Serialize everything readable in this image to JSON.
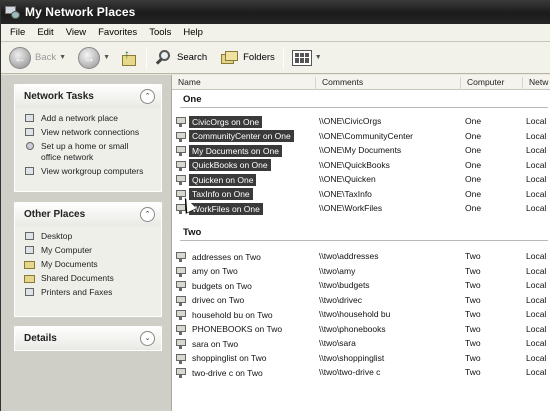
{
  "window": {
    "title": "My Network Places"
  },
  "menu": [
    "File",
    "Edit",
    "View",
    "Favorites",
    "Tools",
    "Help"
  ],
  "toolbar": {
    "back_label": "Back",
    "search_label": "Search",
    "folders_label": "Folders"
  },
  "left": {
    "network_tasks": {
      "title": "Network Tasks",
      "items": [
        "Add a network place",
        "View network connections",
        "Set up a home or small office network",
        "View workgroup computers"
      ]
    },
    "other_places": {
      "title": "Other Places",
      "items": [
        "Desktop",
        "My Computer",
        "My Documents",
        "Shared Documents",
        "Printers and Faxes"
      ]
    },
    "details": {
      "title": "Details"
    }
  },
  "columns": {
    "name": "Name",
    "comments": "Comments",
    "computer": "Computer",
    "network": "Netw"
  },
  "groups": [
    {
      "title": "One",
      "rows": [
        {
          "name": "CivicOrgs on One",
          "comment": "\\\\ONE\\CivicOrgs",
          "computer": "One",
          "network": "Local"
        },
        {
          "name": "CommunityCenter on One",
          "comment": "\\\\ONE\\CommunityCenter",
          "computer": "One",
          "network": "Local"
        },
        {
          "name": "My Documents on One",
          "comment": "\\\\ONE\\My Documents",
          "computer": "One",
          "network": "Local"
        },
        {
          "name": "QuickBooks on One",
          "comment": "\\\\ONE\\QuickBooks",
          "computer": "One",
          "network": "Local"
        },
        {
          "name": "Quicken on One",
          "comment": "\\\\ONE\\Quicken",
          "computer": "One",
          "network": "Local"
        },
        {
          "name": "TaxInfo on One",
          "comment": "\\\\ONE\\TaxInfo",
          "computer": "One",
          "network": "Local"
        },
        {
          "name": "WorkFiles on One",
          "comment": "\\\\ONE\\WorkFiles",
          "computer": "One",
          "network": "Local"
        }
      ]
    },
    {
      "title": "Two",
      "rows": [
        {
          "name": "addresses on Two",
          "comment": "\\\\two\\addresses",
          "computer": "Two",
          "network": "Local"
        },
        {
          "name": "amy on Two",
          "comment": "\\\\two\\amy",
          "computer": "Two",
          "network": "Local"
        },
        {
          "name": "budgets on Two",
          "comment": "\\\\two\\budgets",
          "computer": "Two",
          "network": "Local"
        },
        {
          "name": "drivec on Two",
          "comment": "\\\\two\\drivec",
          "computer": "Two",
          "network": "Local"
        },
        {
          "name": "household bu on Two",
          "comment": "\\\\two\\household bu",
          "computer": "Two",
          "network": "Local"
        },
        {
          "name": "PHONEBOOKS on Two",
          "comment": "\\\\two\\phonebooks",
          "computer": "Two",
          "network": "Local"
        },
        {
          "name": "sara on Two",
          "comment": "\\\\two\\sara",
          "computer": "Two",
          "network": "Local"
        },
        {
          "name": "shoppinglist on Two",
          "comment": "\\\\two\\shoppinglist",
          "computer": "Two",
          "network": "Local"
        },
        {
          "name": "two-drive c on Two",
          "comment": "\\\\two\\two-drive c",
          "computer": "Two",
          "network": "Local"
        }
      ]
    }
  ]
}
